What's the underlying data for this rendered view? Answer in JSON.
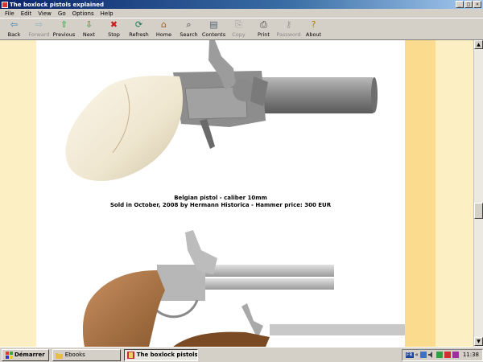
{
  "window": {
    "title": "The boxlock pistols explained"
  },
  "menu": [
    "File",
    "Edit",
    "View",
    "Go",
    "Options",
    "Help"
  ],
  "toolbar": [
    {
      "label": "Back",
      "icon": "back-arrow-icon",
      "glyph": "⇦",
      "color": "#2f7fb8",
      "enabled": true
    },
    {
      "label": "Forward",
      "icon": "forward-arrow-icon",
      "glyph": "⇨",
      "color": "#2f7fb8",
      "enabled": false
    },
    {
      "label": "Previous",
      "icon": "up-arrow-icon",
      "glyph": "⇧",
      "color": "#1e9a2e",
      "enabled": true
    },
    {
      "label": "Next",
      "icon": "down-arrow-icon",
      "glyph": "⇩",
      "color": "#1e9a2e",
      "enabled": true
    },
    {
      "label": "Stop",
      "icon": "stop-icon",
      "glyph": "✖",
      "color": "#d01818",
      "enabled": true
    },
    {
      "label": "Refresh",
      "icon": "refresh-icon",
      "glyph": "⟳",
      "color": "#207050",
      "enabled": true
    },
    {
      "label": "Home",
      "icon": "home-icon",
      "glyph": "⌂",
      "color": "#a06020",
      "enabled": true
    },
    {
      "label": "Search",
      "icon": "search-icon",
      "glyph": "⌕",
      "color": "#404040",
      "enabled": true
    },
    {
      "label": "Contents",
      "icon": "contents-icon",
      "glyph": "▤",
      "color": "#506070",
      "enabled": true
    },
    {
      "label": "Copy",
      "icon": "copy-icon",
      "glyph": "⎘",
      "color": "#606060",
      "enabled": false
    },
    {
      "label": "Print",
      "icon": "print-icon",
      "glyph": "⎙",
      "color": "#404040",
      "enabled": true
    },
    {
      "label": "Password",
      "icon": "key-icon",
      "glyph": "⚷",
      "color": "#606060",
      "enabled": false
    },
    {
      "label": "About",
      "icon": "about-icon",
      "glyph": "?",
      "color": "#b08000",
      "enabled": true
    }
  ],
  "caption": {
    "line1": "Belgian pistol - caliber 10mm",
    "line2": "Sold in October, 2008 by Hermann Historica - Hammer price: 300 EUR"
  },
  "taskbar": {
    "start_label": "Démarrer",
    "tasks": [
      {
        "label": "Ebooks",
        "active": false
      },
      {
        "label": "The boxlock pistols e...",
        "active": true
      }
    ],
    "tray_prefix": "FR",
    "clock": "11:38"
  },
  "colors": {
    "page_background": "#fdefc4",
    "stripe": "#fbdc8f",
    "titlebar": "#0a246a"
  }
}
